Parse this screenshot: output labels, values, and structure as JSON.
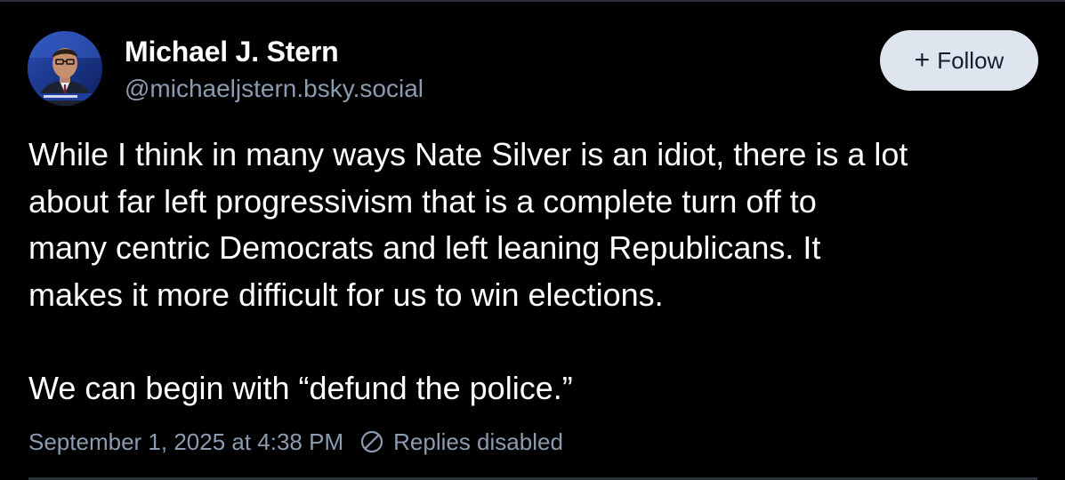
{
  "author": {
    "display_name": "Michael J. Stern",
    "handle": "@michaeljstern.bsky.social",
    "avatar_icon": "profile-photo"
  },
  "follow_button": {
    "icon": "plus-icon",
    "icon_glyph": "+",
    "label": "Follow"
  },
  "post": {
    "lines": [
      "While I think in many ways Nate Silver is an idiot, there is a lot",
      "about far left progressivism that is a complete turn off to",
      "many centric Democrats and left leaning Republicans. It",
      "makes it more difficult for us to win elections.",
      "We can begin with “defund the police.”"
    ],
    "timestamp": "September 1, 2025 at 4:38 PM",
    "replies_status": "Replies disabled",
    "replies_icon": "no-entry-icon"
  },
  "colors": {
    "background": "#000000",
    "text": "#ffffff",
    "muted": "#8b9bb0",
    "button_bg": "#dfe5ee",
    "button_text": "#14202e"
  }
}
